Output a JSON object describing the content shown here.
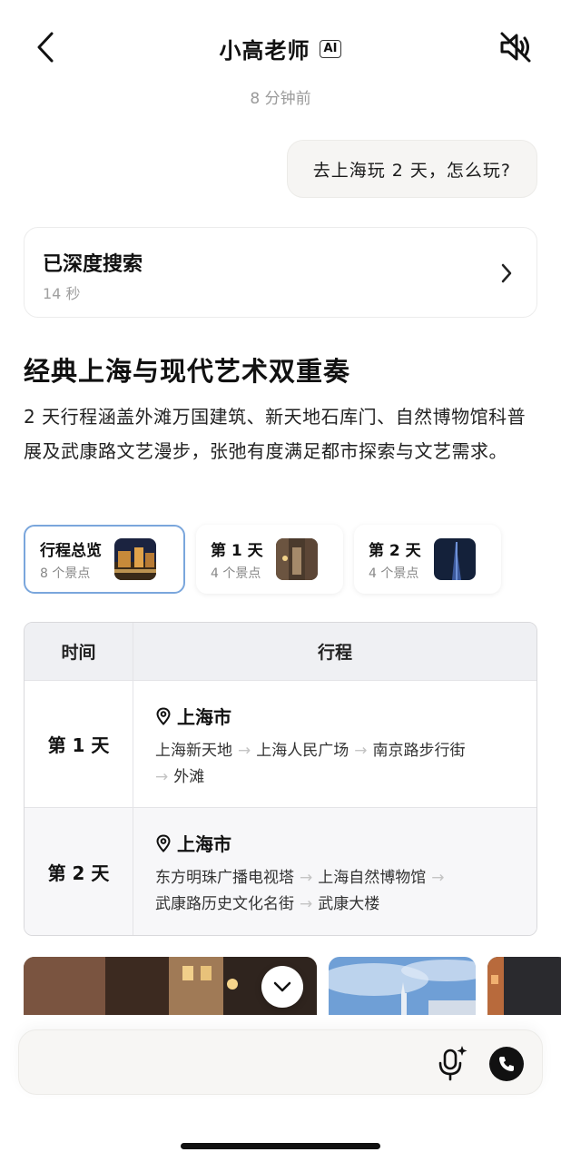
{
  "header": {
    "title": "小高老师",
    "ai_badge": "AI",
    "back_icon": "chevron-left-icon",
    "mute_icon": "speaker-muted-icon"
  },
  "timestamp": "8 分钟前",
  "user_message": "去上海玩 2 天，怎么玩?",
  "search_card": {
    "title": "已深度搜索",
    "duration": "14 秒"
  },
  "answer": {
    "title": "经典上海与现代艺术双重奏",
    "description": "2 天行程涵盖外滩万国建筑、新天地石库门、自然博物馆科普展及武康路文艺漫步，张弛有度满足都市探索与文艺需求。"
  },
  "tabs": [
    {
      "label": "行程总览",
      "count": "8 个景点",
      "active": true
    },
    {
      "label": "第 1 天",
      "count": "4 个景点",
      "active": false
    },
    {
      "label": "第 2 天",
      "count": "4 个景点",
      "active": false
    }
  ],
  "itinerary": {
    "headers": {
      "time": "时间",
      "plan": "行程"
    },
    "rows": [
      {
        "day": "第 1 天",
        "city": "上海市",
        "stops": [
          "上海新天地",
          "上海人民广场",
          "南京路步行街",
          "外滩"
        ]
      },
      {
        "day": "第 2 天",
        "city": "上海市",
        "stops": [
          "东方明珠广播电视塔",
          "上海自然博物馆",
          "武康路历史文化名街",
          "武康大楼"
        ]
      }
    ]
  },
  "input": {
    "placeholder": ""
  },
  "colors": {
    "active_tab_border": "#7aa6dc",
    "table_header_bg": "#eff0f3",
    "bubble_bg": "#f6f5f3"
  }
}
